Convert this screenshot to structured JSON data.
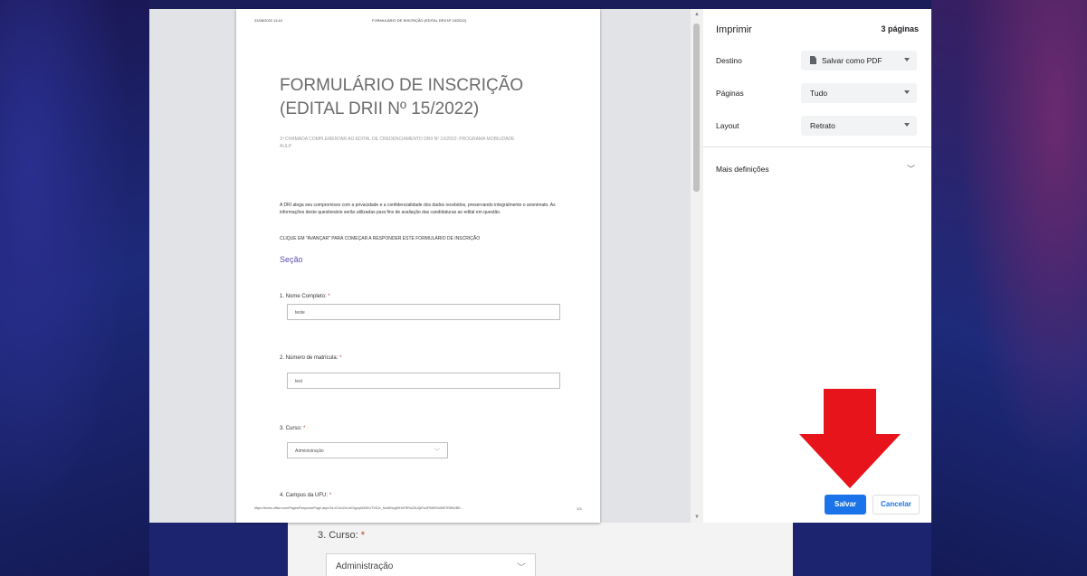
{
  "document": {
    "header_date": "22/08/2022 11:44",
    "header_title": "FORMULÁRIO DE INSCRIÇÃO (EDITAL DRII Nº 15/2022)",
    "title_line1": "FORMULÁRIO DE INSCRIÇÃO",
    "title_line2": "(EDITAL DRII Nº 15/2022)",
    "subtitle": "1ª CHAMADA COMPLEMENTAR AO EDITAL DE CREDENCIAMENTO DRII Nº 10/2022: PROGRAMA MOBILIDADE AULP",
    "intro": "A DRI alega seu compromisso com a privacidade e a confidencialidade dos dados recebidos, preservando integralmente o anonimato. As informações deste questionário serão utilizadas para fins de avaliação das candidaturas ao edital em questão.",
    "click_note": "CLIQUE EM \"AVANÇAR\" PARA COMEÇAR A RESPONDER ESTE FORMULÁRIO DE INSCRIÇÃO",
    "section": "Seção",
    "questions": [
      {
        "label": "1. Nome Completo:",
        "required": "*",
        "value": "teste"
      },
      {
        "label": "2. Número de matrícula:",
        "required": "*",
        "value": "test"
      },
      {
        "label": "3. Curso:",
        "required": "*",
        "value": "Administração"
      },
      {
        "label": "4. Campus da UFU:",
        "required": "*"
      }
    ],
    "footer_url": "https://forms.office.com/Pages/ResponsePage.aspx?id=l21xxZnLiUGlgxqGbDEUTXDJc_MuWNxgWHdTRRsZ5UQIEsUFBWR0d9WTR8NVBE…",
    "footer_page": "1/3"
  },
  "print_panel": {
    "title": "Imprimir",
    "pages_count": "3 páginas",
    "destination_label": "Destino",
    "destination_value": "Salvar como PDF",
    "pages_label": "Páginas",
    "pages_value": "Tudo",
    "layout_label": "Layout",
    "layout_value": "Retrato",
    "more_settings": "Mais definições",
    "save_button": "Salvar",
    "cancel_button": "Cancelar"
  },
  "background_page": {
    "question": "3. Curso:",
    "required": "*",
    "value": "Administração"
  },
  "colors": {
    "accent": "#1a73e8",
    "arrow": "#e8141b",
    "section": "#5c4fb0",
    "required": "#c0392b"
  }
}
